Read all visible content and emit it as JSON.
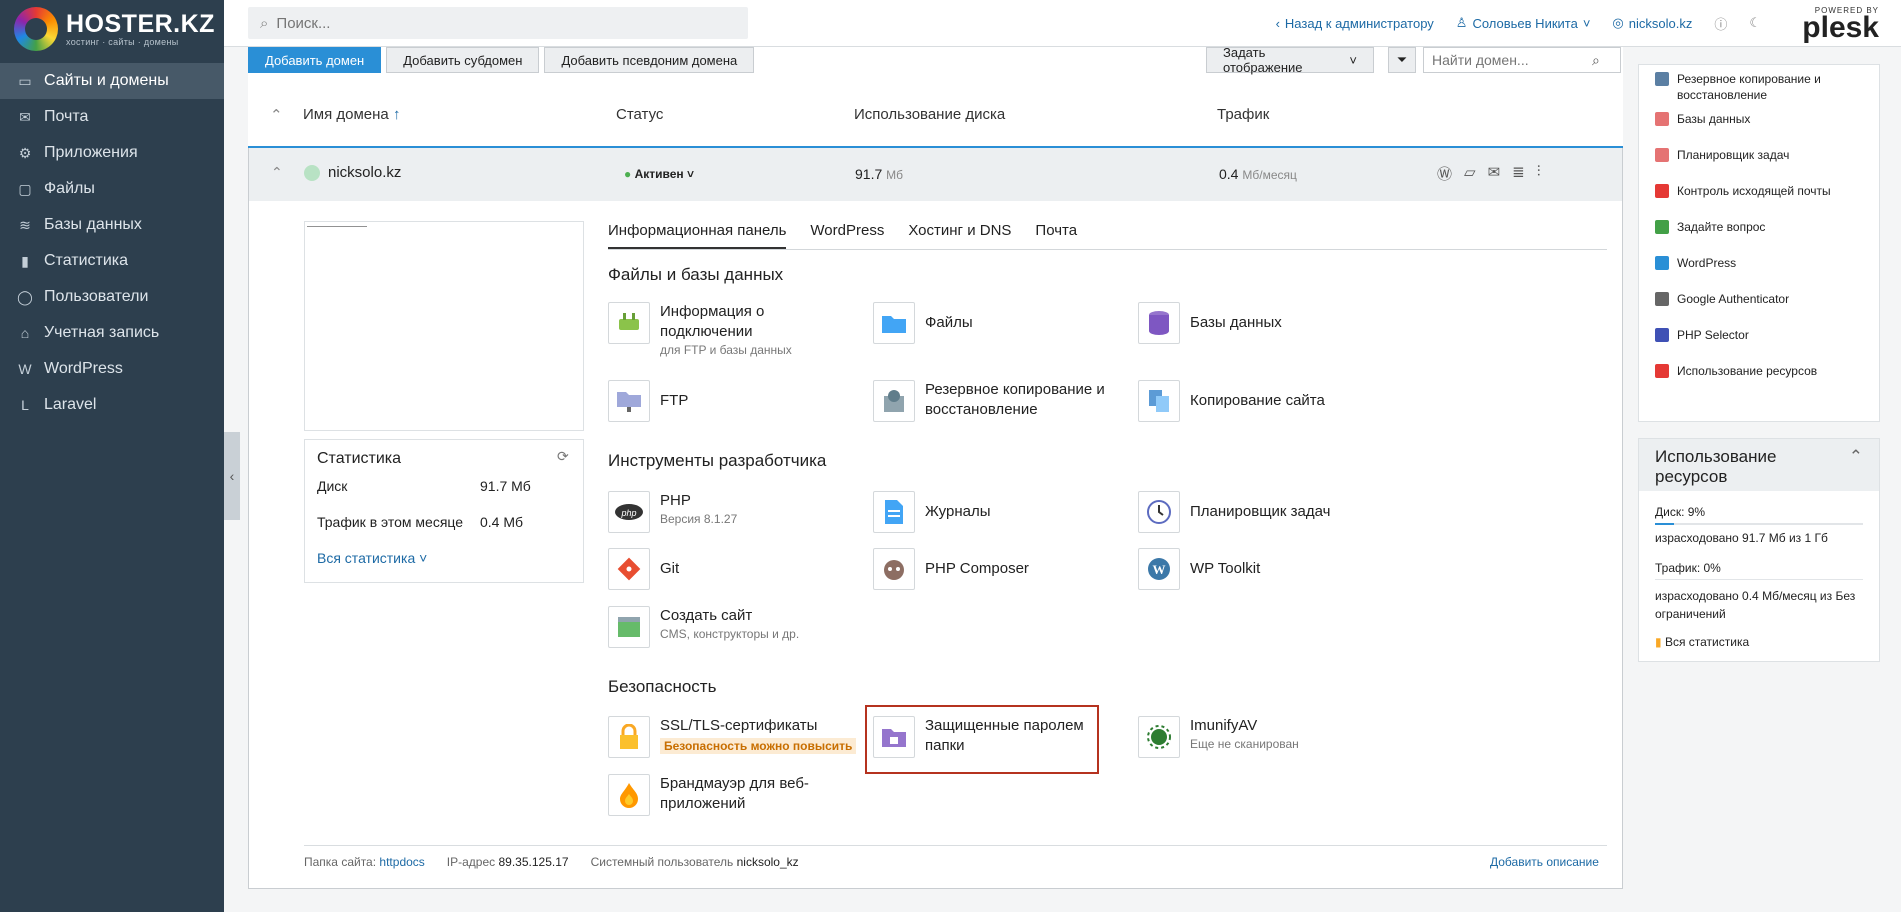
{
  "brand": {
    "name": "HOSTER.KZ",
    "tagline": "хостинг · сайты · домены"
  },
  "sidebar": {
    "items": [
      {
        "label": "Сайты и домены",
        "icon": "monitor-icon",
        "glyph": "▭",
        "active": true
      },
      {
        "label": "Почта",
        "icon": "mail-icon",
        "glyph": "✉"
      },
      {
        "label": "Приложения",
        "icon": "gear-icon",
        "glyph": "⚙"
      },
      {
        "label": "Файлы",
        "icon": "folder-icon",
        "glyph": "▢"
      },
      {
        "label": "Базы данных",
        "icon": "layers-icon",
        "glyph": "≋"
      },
      {
        "label": "Статистика",
        "icon": "bar-chart-icon",
        "glyph": "▮"
      },
      {
        "label": "Пользователи",
        "icon": "user-icon",
        "glyph": "◯"
      },
      {
        "label": "Учетная запись",
        "icon": "account-icon",
        "glyph": "⌂"
      },
      {
        "label": "WordPress",
        "icon": "wordpress-icon",
        "glyph": "W"
      },
      {
        "label": "Laravel",
        "icon": "laravel-icon",
        "glyph": "L"
      }
    ]
  },
  "topbar": {
    "search_placeholder": "Поиск...",
    "back_link": "Назад к администратору",
    "user": "Соловьев Никита",
    "domain": "nicksolo.kz",
    "powered_by": "POWERED BY",
    "plesk": "plesk"
  },
  "actions": {
    "add_domain": "Добавить домен",
    "add_subdomain": "Добавить субдомен",
    "add_alias": "Добавить псевдоним домена",
    "view": "Задать отображение",
    "domain_search_placeholder": "Найти домен..."
  },
  "columns": {
    "name": "Имя домена",
    "status": "Статус",
    "disk": "Использование диска",
    "traffic": "Трафик"
  },
  "domain": {
    "name": "nicksolo.kz",
    "status": "Активен",
    "disk_value": "91.7",
    "disk_unit": "Мб",
    "traffic_value": "0.4",
    "traffic_unit": "Мб/месяц"
  },
  "stats": {
    "title": "Статистика",
    "disk_label": "Диск",
    "disk_value": "91.7 Мб",
    "traffic_label": "Трафик в этом месяце",
    "traffic_value": "0.4 Мб",
    "all_link": "Вся статистика"
  },
  "tabs": [
    "Информационная панель",
    "WordPress",
    "Хостинг и DNS",
    "Почта"
  ],
  "sections": {
    "files": "Файлы и базы данных",
    "dev": "Инструменты разработчика",
    "security": "Безопасность"
  },
  "tools": {
    "connection": {
      "title": "Информация о подключении",
      "sub": "для FTP и базы данных"
    },
    "files": {
      "title": "Файлы"
    },
    "databases": {
      "title": "Базы данных"
    },
    "ftp": {
      "title": "FTP"
    },
    "backup": {
      "title": "Резервное копирование и восстановление"
    },
    "copy_site": {
      "title": "Копирование сайта"
    },
    "php": {
      "title": "PHP",
      "sub": "Версия 8.1.27"
    },
    "logs": {
      "title": "Журналы"
    },
    "scheduler": {
      "title": "Планировщик задач"
    },
    "git": {
      "title": "Git"
    },
    "composer": {
      "title": "PHP Composer"
    },
    "wp_toolkit": {
      "title": "WP Toolkit"
    },
    "create_site": {
      "title": "Создать сайт",
      "sub": "CMS, конструкторы и др."
    },
    "ssl": {
      "title": "SSL/TLS-сертификаты",
      "badge": "Безопасность можно повысить"
    },
    "protected_dirs": {
      "title": "Защищенные паролем папки"
    },
    "imunify": {
      "title": "ImunifyAV",
      "sub": "Еще не сканирован"
    },
    "waf": {
      "title": "Брандмауэр для веб-приложений"
    }
  },
  "footer": {
    "folder_label": "Папка сайта:",
    "folder_value": "httpdocs",
    "ip_label": "IP-адрес",
    "ip_value": "89.35.125.17",
    "user_label": "Системный пользователь",
    "user_value": "nicksolo_kz",
    "add_description": "Добавить описание"
  },
  "right_panel": {
    "links": [
      {
        "label": "Резервное копирование и восстановление",
        "color": "#5b7fa3"
      },
      {
        "label": "Базы данных",
        "color": "#e57373"
      },
      {
        "label": "Планировщик задач",
        "color": "#e57373"
      },
      {
        "label": "Контроль исходящей почты",
        "color": "#e53935"
      },
      {
        "label": "Задайте вопрос",
        "color": "#43a047"
      },
      {
        "label": "WordPress",
        "color": "#2a8fd6"
      },
      {
        "label": "Google Authenticator",
        "color": "#666666"
      },
      {
        "label": "PHP Selector",
        "color": "#3f51b5"
      },
      {
        "label": "Использование ресурсов",
        "color": "#e53935"
      }
    ],
    "usage": {
      "title": "Использование ресурсов",
      "disk_label": "Диск: 9%",
      "disk_percent": 9,
      "disk_detail": "израсходовано 91.7 Мб из 1 Гб",
      "traffic_label": "Трафик: 0%",
      "traffic_detail": "израсходовано 0.4 Мб/месяц из Без ограничений",
      "all_link": "Вся статистика"
    }
  }
}
